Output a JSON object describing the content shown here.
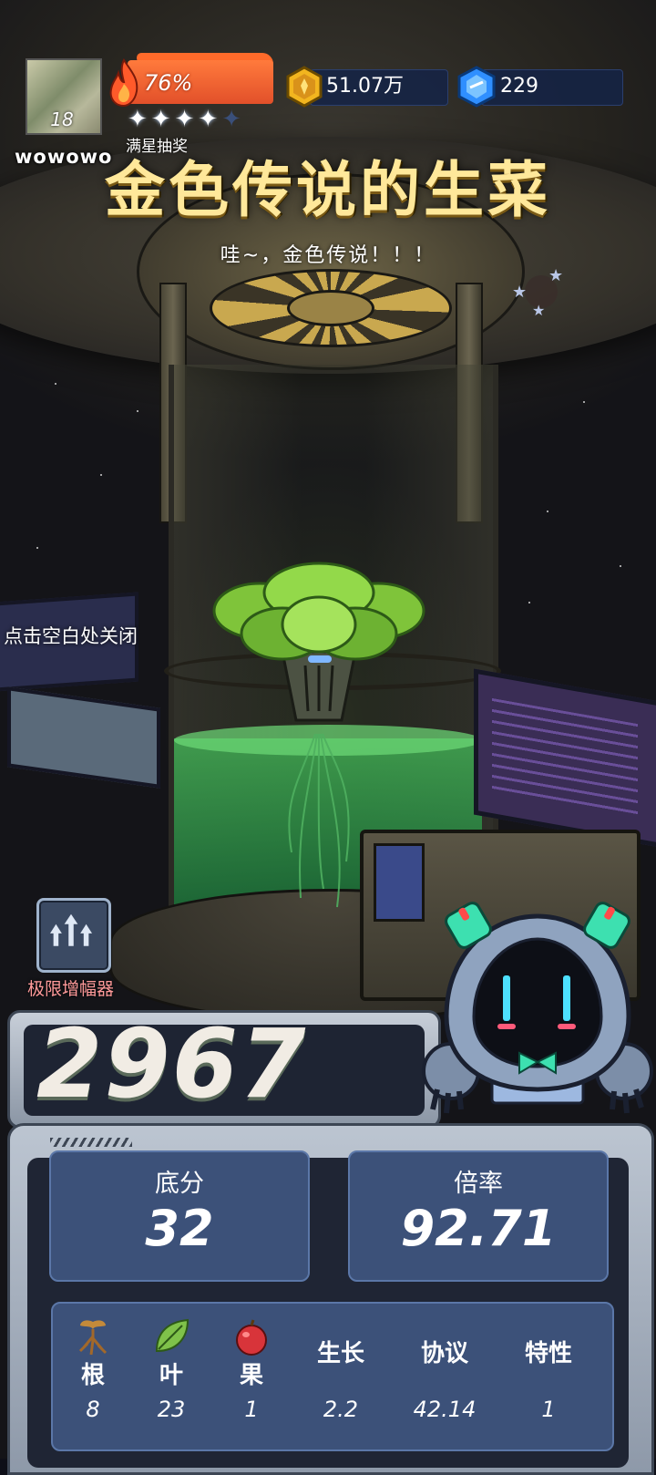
{
  "player": {
    "name": "wowowo",
    "level": "18"
  },
  "energy": {
    "percent_text": "76%",
    "percent": 76,
    "stars_filled": 4,
    "stars_total": 5,
    "star_draw_label": "满星抽奖"
  },
  "currency": {
    "coins": "51.07万",
    "gems": "229"
  },
  "reward": {
    "title": "金色传说的生菜",
    "subtitle": "哇~，金色传说！！！"
  },
  "hint": {
    "close": "点击空白处关闭"
  },
  "amplifier": {
    "label": "极限增幅器",
    "icon": "triple-up-arrow-icon"
  },
  "score": "2967",
  "base_score": {
    "label": "底分",
    "value": "32"
  },
  "multiplier": {
    "label": "倍率",
    "value": "92.71"
  },
  "stats": [
    {
      "label": "根",
      "value": "8",
      "icon": "sprout-root-icon"
    },
    {
      "label": "叶",
      "value": "23",
      "icon": "leaf-icon"
    },
    {
      "label": "果",
      "value": "1",
      "icon": "apple-icon"
    },
    {
      "label": "生长",
      "value": "2.2"
    },
    {
      "label": "协议",
      "value": "42.14"
    },
    {
      "label": "特性",
      "value": "1"
    }
  ],
  "colors": {
    "energy": "#e2502a",
    "title": "#ffe89a",
    "panel_box": "#3c5179",
    "liquid": "#46be5a",
    "amp_label": "#ff9a9a"
  }
}
